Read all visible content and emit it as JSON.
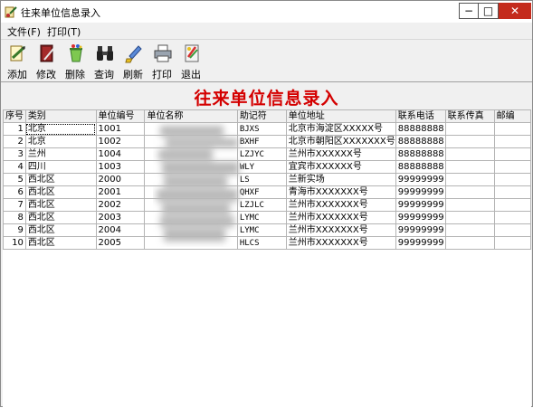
{
  "window": {
    "title": "往来单位信息录入"
  },
  "menu": [
    {
      "label": "文件(F)"
    },
    {
      "label": "打印(T)"
    }
  ],
  "toolbar": [
    {
      "label": "添加",
      "icon": "add-document-icon"
    },
    {
      "label": "修改",
      "icon": "edit-book-icon"
    },
    {
      "label": "删除",
      "icon": "recycle-bin-icon"
    },
    {
      "label": "查询",
      "icon": "binoculars-icon"
    },
    {
      "label": "刷新",
      "icon": "paint-brush-icon"
    },
    {
      "label": "打印",
      "icon": "printer-icon"
    },
    {
      "label": "退出",
      "icon": "exit-icon"
    }
  ],
  "heading": "往来单位信息录入",
  "table": {
    "columns": [
      "序号",
      "类别",
      "单位编号",
      "单位名称",
      "助记符",
      "单位地址",
      "联系电话",
      "联系传真",
      "邮编"
    ],
    "rows": [
      [
        "1",
        "北京",
        "1001",
        "",
        "BJXS",
        "北京市海淀区XXXXX号",
        "88888888",
        "",
        ""
      ],
      [
        "2",
        "北京",
        "1002",
        "",
        "BXHF",
        "北京市朝阳区XXXXXXX号",
        "88888888",
        "",
        ""
      ],
      [
        "3",
        "兰州",
        "1004",
        "",
        "LZJYC",
        "兰州市XXXXXX号",
        "88888888",
        "",
        ""
      ],
      [
        "4",
        "四川",
        "1003",
        "",
        "WLY",
        "宜宾市XXXXXX号",
        "88888888",
        "",
        ""
      ],
      [
        "5",
        "西北区",
        "2000",
        "",
        "LS",
        "兰新实场",
        "99999999",
        "",
        ""
      ],
      [
        "6",
        "西北区",
        "2001",
        "",
        "QHXF",
        "青海市XXXXXXX号",
        "99999999",
        "",
        ""
      ],
      [
        "7",
        "西北区",
        "2002",
        "",
        "LZJLC",
        "兰州市XXXXXXX号",
        "99999999",
        "",
        ""
      ],
      [
        "8",
        "西北区",
        "2003",
        "",
        "LYMC",
        "兰州市XXXXXXX号",
        "99999999",
        "",
        ""
      ],
      [
        "9",
        "西北区",
        "2004",
        "",
        "LYMC",
        "兰州市XXXXXXX号",
        "99999999",
        "",
        ""
      ],
      [
        "10",
        "西北区",
        "2005",
        "",
        "HLCS",
        "兰州市XXXXXXX号",
        "99999999",
        "",
        ""
      ]
    ]
  },
  "colors": {
    "heading": "#d40000",
    "close": "#c42b1c"
  }
}
